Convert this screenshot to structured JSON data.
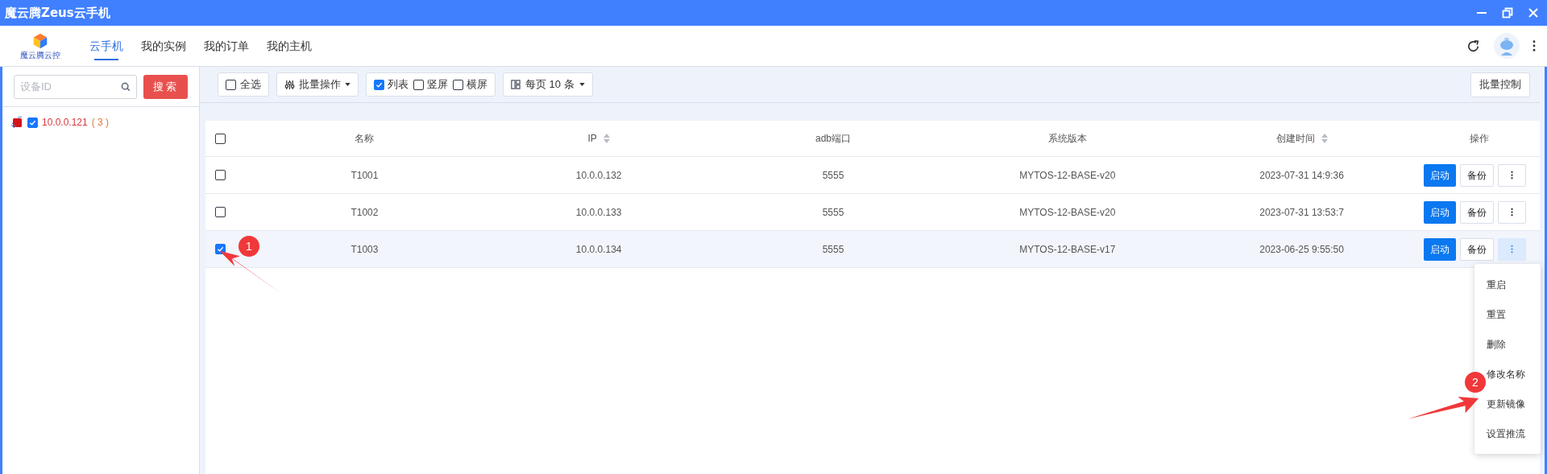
{
  "window": {
    "title": "魔云腾Zeus云手机"
  },
  "header": {
    "logo_text": "魔云腾云控",
    "nav": [
      {
        "label": "云手机",
        "selected": true
      },
      {
        "label": "我的实例",
        "selected": false
      },
      {
        "label": "我的订单",
        "selected": false
      },
      {
        "label": "我的主机",
        "selected": false
      }
    ]
  },
  "sidebar": {
    "search": {
      "placeholder": "设备ID"
    },
    "search_button": "搜索",
    "tree": [
      {
        "label": "10.0.0.121",
        "count": "( 3 )",
        "checked": true
      }
    ]
  },
  "toolbar": {
    "select_all": {
      "label": "全选",
      "checked": false
    },
    "batch_menu": "批量操作",
    "views": [
      {
        "label": "列表",
        "checked": true
      },
      {
        "label": "竖屏",
        "checked": false
      },
      {
        "label": "横屏",
        "checked": false
      }
    ],
    "page_size": "每页 10 条",
    "batch_control": "批量控制"
  },
  "table": {
    "header_checked": false,
    "columns": [
      {
        "label": "名称",
        "sortable": false
      },
      {
        "label": "IP",
        "sortable": true
      },
      {
        "label": "adb端口",
        "sortable": false
      },
      {
        "label": "系统版本",
        "sortable": false
      },
      {
        "label": "创建时间",
        "sortable": true
      },
      {
        "label": "操作",
        "sortable": false
      }
    ],
    "rows": [
      {
        "selected": false,
        "cells": [
          "T1001",
          "10.0.0.132",
          "5555",
          "MYTOS-12-BASE-v20",
          "2023-07-31 14:9:36"
        ],
        "start": "启动",
        "backup": "备份",
        "menu_open": false
      },
      {
        "selected": false,
        "cells": [
          "T1002",
          "10.0.0.133",
          "5555",
          "MYTOS-12-BASE-v20",
          "2023-07-31 13:53:7"
        ],
        "start": "启动",
        "backup": "备份",
        "menu_open": false
      },
      {
        "selected": true,
        "cells": [
          "T1003",
          "10.0.0.134",
          "5555",
          "MYTOS-12-BASE-v17",
          "2023-06-25 9:55:50"
        ],
        "start": "启动",
        "backup": "备份",
        "menu_open": true
      }
    ]
  },
  "dropdown_menu": [
    "重启",
    "重置",
    "删除",
    "修改名称",
    "更新镜像",
    "设置推流"
  ],
  "annotations": [
    {
      "label": "1"
    },
    {
      "label": "2"
    }
  ]
}
